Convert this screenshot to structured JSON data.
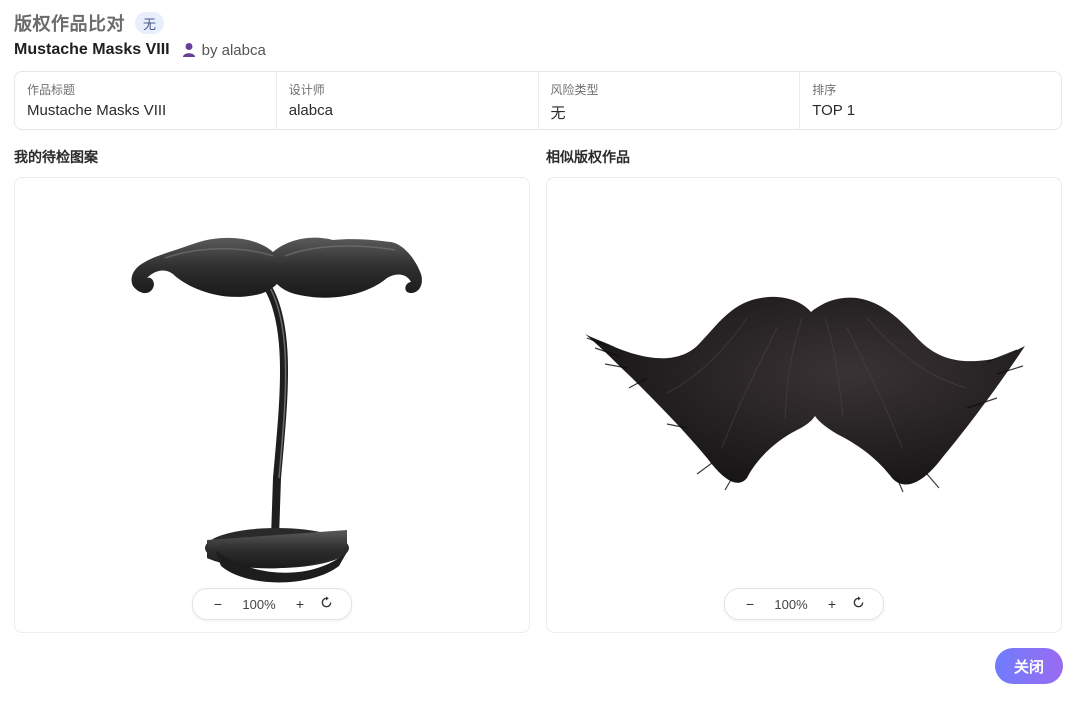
{
  "header": {
    "title": "版权作品比对",
    "badge": "无",
    "work_name": "Mustache Masks VIII",
    "author": "by alabca"
  },
  "info": [
    {
      "label": "作品标题",
      "value": "Mustache Masks VIII"
    },
    {
      "label": "设计师",
      "value": "alabca"
    },
    {
      "label": "风险类型",
      "value": "无"
    },
    {
      "label": "排序",
      "value": "TOP 1"
    }
  ],
  "left_panel": {
    "title": "我的待检图案",
    "zoom": "100%",
    "image_icon": "plastic-mustache-on-stick-image"
  },
  "right_panel": {
    "title": "相似版权作品",
    "zoom": "100%",
    "image_icon": "hairy-mustache-image"
  },
  "zoom_controls": {
    "minus": "−",
    "plus": "+",
    "reset_icon": "rotate-reset-icon"
  },
  "footer": {
    "close_label": "关闭"
  },
  "colors": {
    "accent_start": "#6f7dfb",
    "accent_end": "#9a6bf2",
    "author_icon": "#6a3f9a"
  }
}
